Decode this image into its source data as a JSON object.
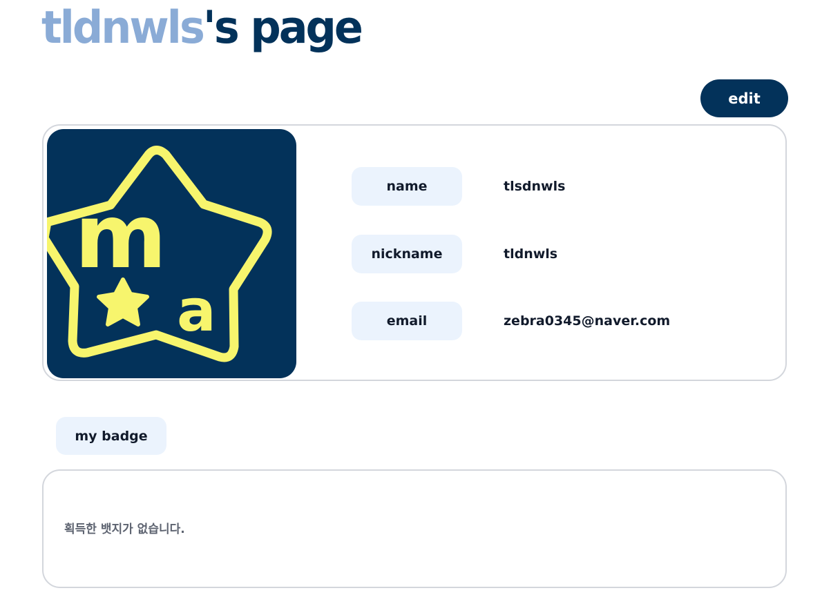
{
  "header": {
    "username": "tldnwls",
    "title_suffix": "'s page"
  },
  "actions": {
    "edit_label": "edit"
  },
  "profile": {
    "avatar_letters": [
      "m",
      "a"
    ],
    "fields": [
      {
        "label": "name",
        "value": "tlsdnwls"
      },
      {
        "label": "nickname",
        "value": "tldnwls"
      },
      {
        "label": "email",
        "value": "zebra0345@naver.com"
      }
    ]
  },
  "badges": {
    "header_label": "my badge",
    "empty_message": "획득한 뱃지가 없습니다."
  },
  "colors": {
    "primary": "#03325a",
    "title_accent": "#8aabd6",
    "label_bg": "#ebf3fd",
    "logo_yellow": "#f7f56d",
    "border": "#d3d6dc"
  }
}
